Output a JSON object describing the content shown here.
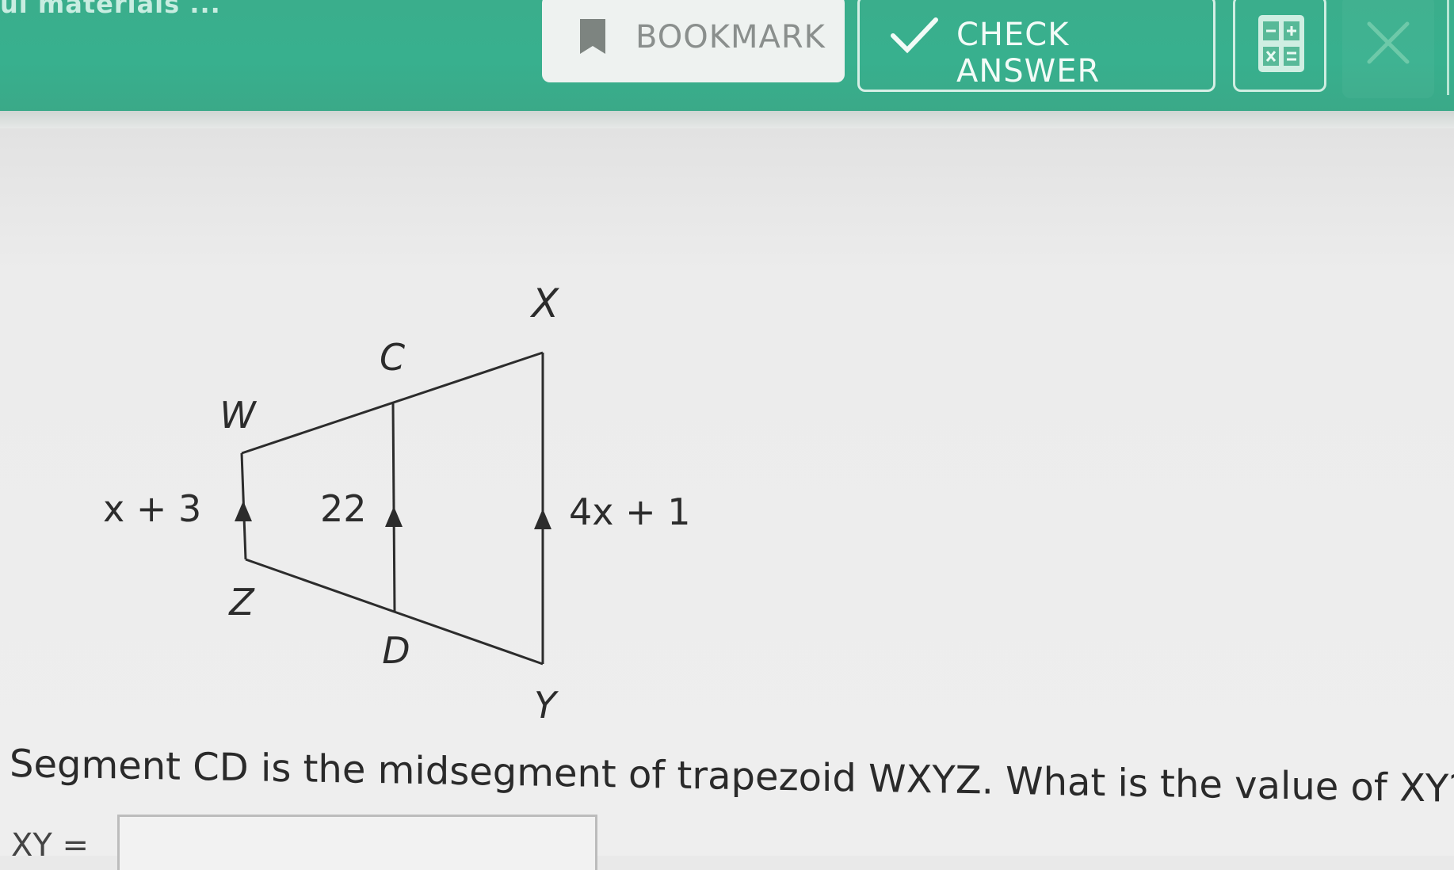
{
  "app": {
    "brand_text": "ui materials ..."
  },
  "toolbar": {
    "bookmark_label": "BOOKMARK",
    "check_answer_label": "CHECK ANSWER"
  },
  "diagram": {
    "vertices": {
      "W": "W",
      "X": "X",
      "Y": "Y",
      "Z": "Z",
      "C": "C",
      "D": "D"
    },
    "label_left": "x + 3",
    "label_mid": "22",
    "label_right": "4x + 1"
  },
  "question": {
    "text": "Segment CD is the midsegment of trapezoid WXYZ. What is the value of XY?",
    "answer_label": "XY =",
    "answer_value": ""
  },
  "colors": {
    "header_green": "#38b08e",
    "diagram_ink": "#2c2c2c"
  }
}
